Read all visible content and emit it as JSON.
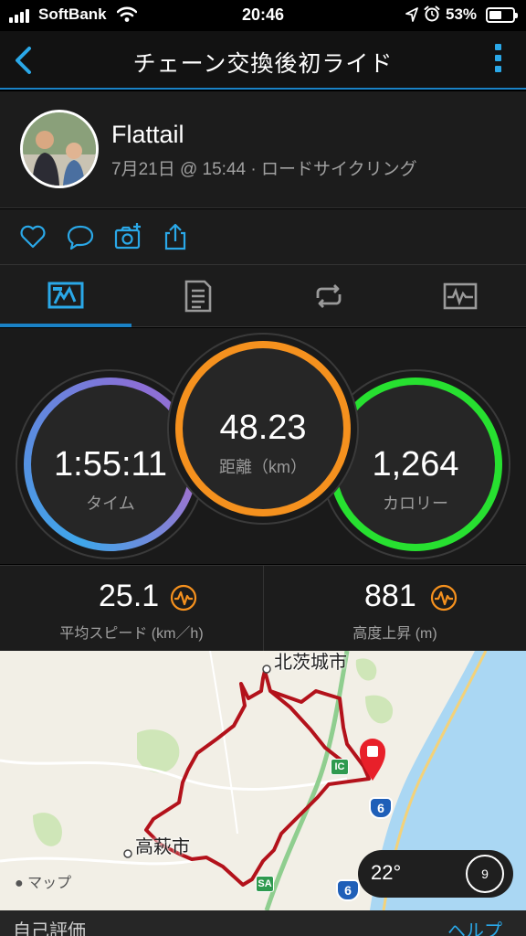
{
  "status_bar": {
    "carrier": "SoftBank",
    "time": "20:46",
    "battery_percent": "53%",
    "battery_level": 0.53
  },
  "header": {
    "title": "チェーン交換後初ライド",
    "accent_color": "#1a82c6"
  },
  "profile": {
    "user_name": "Flattail",
    "meta": "7月21日 @ 15:44 · ロードサイクリング"
  },
  "actions": [
    "heart-icon",
    "comment-icon",
    "camera-add-icon",
    "share-icon"
  ],
  "tabs": [
    {
      "icon": "overview-icon",
      "active": true
    },
    {
      "icon": "details-icon",
      "active": false
    },
    {
      "icon": "laps-icon",
      "active": false
    },
    {
      "icon": "graph-icon",
      "active": false
    }
  ],
  "rings": {
    "time": {
      "value": "1:55:11",
      "label": "タイム",
      "colors": [
        "#3fa6ea",
        "#8b6fd6"
      ]
    },
    "distance": {
      "value": "48.23",
      "label": "距離（km）",
      "color": "#f5911e"
    },
    "calories": {
      "value": "1,264",
      "label": "カロリー",
      "color": "#27e030"
    }
  },
  "stats": {
    "avg_speed": {
      "value": "25.1",
      "label": "平均スピード (km／h)"
    },
    "elevation_gain": {
      "value": "881",
      "label": "高度上昇 (m)"
    },
    "icon_color": "#f5911e"
  },
  "map": {
    "cities": {
      "kitaibaraki": "北茨城市",
      "takahagi": "高萩市"
    },
    "apple_maps": "マップ",
    "route_color": "#b3121b",
    "road_badges": {
      "ic": "IC",
      "sa": "SA",
      "route6a": "6",
      "route6b": "6"
    },
    "weather": {
      "temperature": "22°",
      "wind": "9"
    }
  },
  "bottom": {
    "self_evaluation": "自己評価",
    "help": "ヘルプ"
  }
}
